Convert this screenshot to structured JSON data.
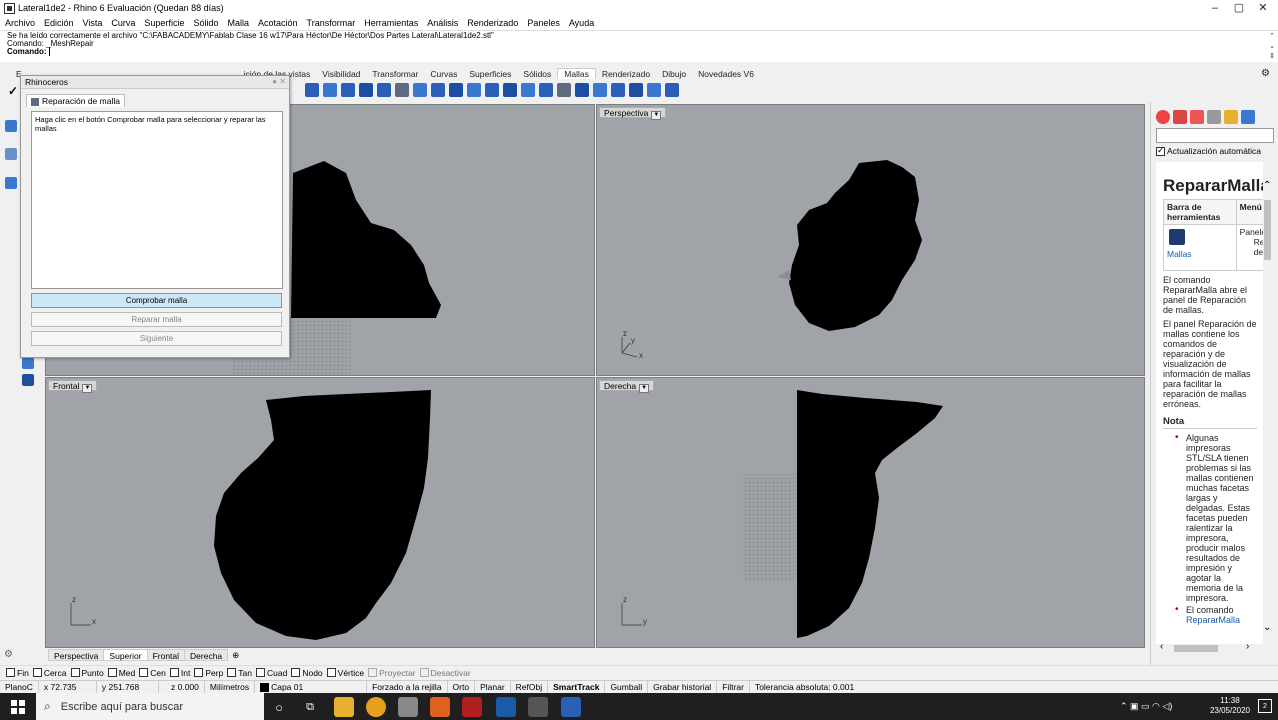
{
  "window": {
    "title": "Lateral1de2 - Rhino 6 Evaluación (Quedan 88 días)",
    "minimize": "–",
    "maximize": "▢",
    "close": "✕"
  },
  "menu": [
    "Archivo",
    "Edición",
    "Vista",
    "Curva",
    "Superficie",
    "Sólido",
    "Malla",
    "Acotación",
    "Transformar",
    "Herramientas",
    "Análisis",
    "Renderizado",
    "Paneles",
    "Ayuda"
  ],
  "command_area": {
    "history_1": "Se ha leído correctamente el archivo \"C:\\FABACADEMY\\Fablab Clase 16 w17\\Para Héctor\\De Héctor\\Dos Partes Lateral\\Lateral1de2.stl\"",
    "history_2": "Comando: _MeshRepair",
    "prompt": "Comando:"
  },
  "toolbar_tabs": [
    "E",
    "",
    "",
    "",
    "",
    "ición de las vistas",
    "Visibilidad",
    "Transformar",
    "Curvas",
    "Superficies",
    "Sólidos",
    "Mallas",
    "Renderizado",
    "Dibujo",
    "Novedades V6"
  ],
  "toolbar_tabs_active": "Mallas",
  "dialog": {
    "title": "Rhinoceros",
    "tab": "Reparación de malla",
    "message": "Haga clic en el botón Comprobar malla para seleccionar y reparar las mallas",
    "buttons": {
      "check": "Comprobar malla",
      "repair": "Reparar malla",
      "next": "Siguiente"
    }
  },
  "viewports": {
    "top_left": {
      "label": ""
    },
    "perspective": {
      "label": "Perspectiva",
      "axis_z": "z",
      "axis_y": "y",
      "axis_x": "x"
    },
    "front": {
      "label": "Frontal",
      "axis_z": "z",
      "axis_x": "x"
    },
    "right": {
      "label": "Derecha",
      "axis_z": "z",
      "axis_y": "y"
    }
  },
  "viewport_tabs": [
    "Perspectiva",
    "Superior",
    "Frontal",
    "Derecha",
    "⊕"
  ],
  "viewport_tabs_active": "Superior",
  "osnap": {
    "items": [
      "Fin",
      "Cerca",
      "Punto",
      "Med",
      "Cen",
      "Int",
      "Perp",
      "Tan",
      "Cuad",
      "Nodo",
      "Vértice"
    ],
    "disabled_items": [
      "Proyectar",
      "Desactivar"
    ]
  },
  "status": {
    "plane": "PlanoC",
    "x": "x 72.735",
    "y": "y 251.768",
    "z": "z 0.000",
    "units": "Milímetros",
    "layer": "Capa 01",
    "grid_snap": "Forzado a la rejilla",
    "ortho": "Orto",
    "planar": "Planar",
    "osnap": "RefObj",
    "smarttrack": "SmartTrack",
    "gumball": "Gumball",
    "history": "Grabar historial",
    "filter": "Filtrar",
    "tolerance": "Tolerancia absoluta: 0.001"
  },
  "right_panel": {
    "auto_update": "Actualización automática",
    "heading": "RepararMalla",
    "table_col1": "Barra de herramientas",
    "table_col2": "Menú",
    "table_cell_toolbar": "Mallas",
    "table_cell_menu_1": "Paneles",
    "table_cell_menu_2": "Repa",
    "table_cell_menu_3": "de m",
    "para_1": "El comando RepararMalla abre el panel de Reparación de mallas.",
    "para_2": "El panel Reparación de mallas contiene los comandos de reparación y de visualización de información de mallas para facilitar la reparación de mallas erróneas.",
    "note_heading": "Nota",
    "note_1": "Algunas impresoras STL/SLA tienen problemas si las mallas contienen muchas facetas largas y delgadas. Estas facetas pueden ralentizar la impresora, producir malos resultados de impresión y agotar la memoria de la impresora.",
    "note_2_prefix": "El comando",
    "note_2_link": "RepararMalla"
  },
  "taskbar": {
    "search_placeholder": "Escribe aquí para buscar",
    "time": "11:38",
    "date": "23/05/2020",
    "notifications": "2"
  },
  "colors": {
    "viewport_bg": "#a0a4a9",
    "mesh": "#000000",
    "check_button": "#cce8f8",
    "taskbar": "#1f1f1f"
  }
}
